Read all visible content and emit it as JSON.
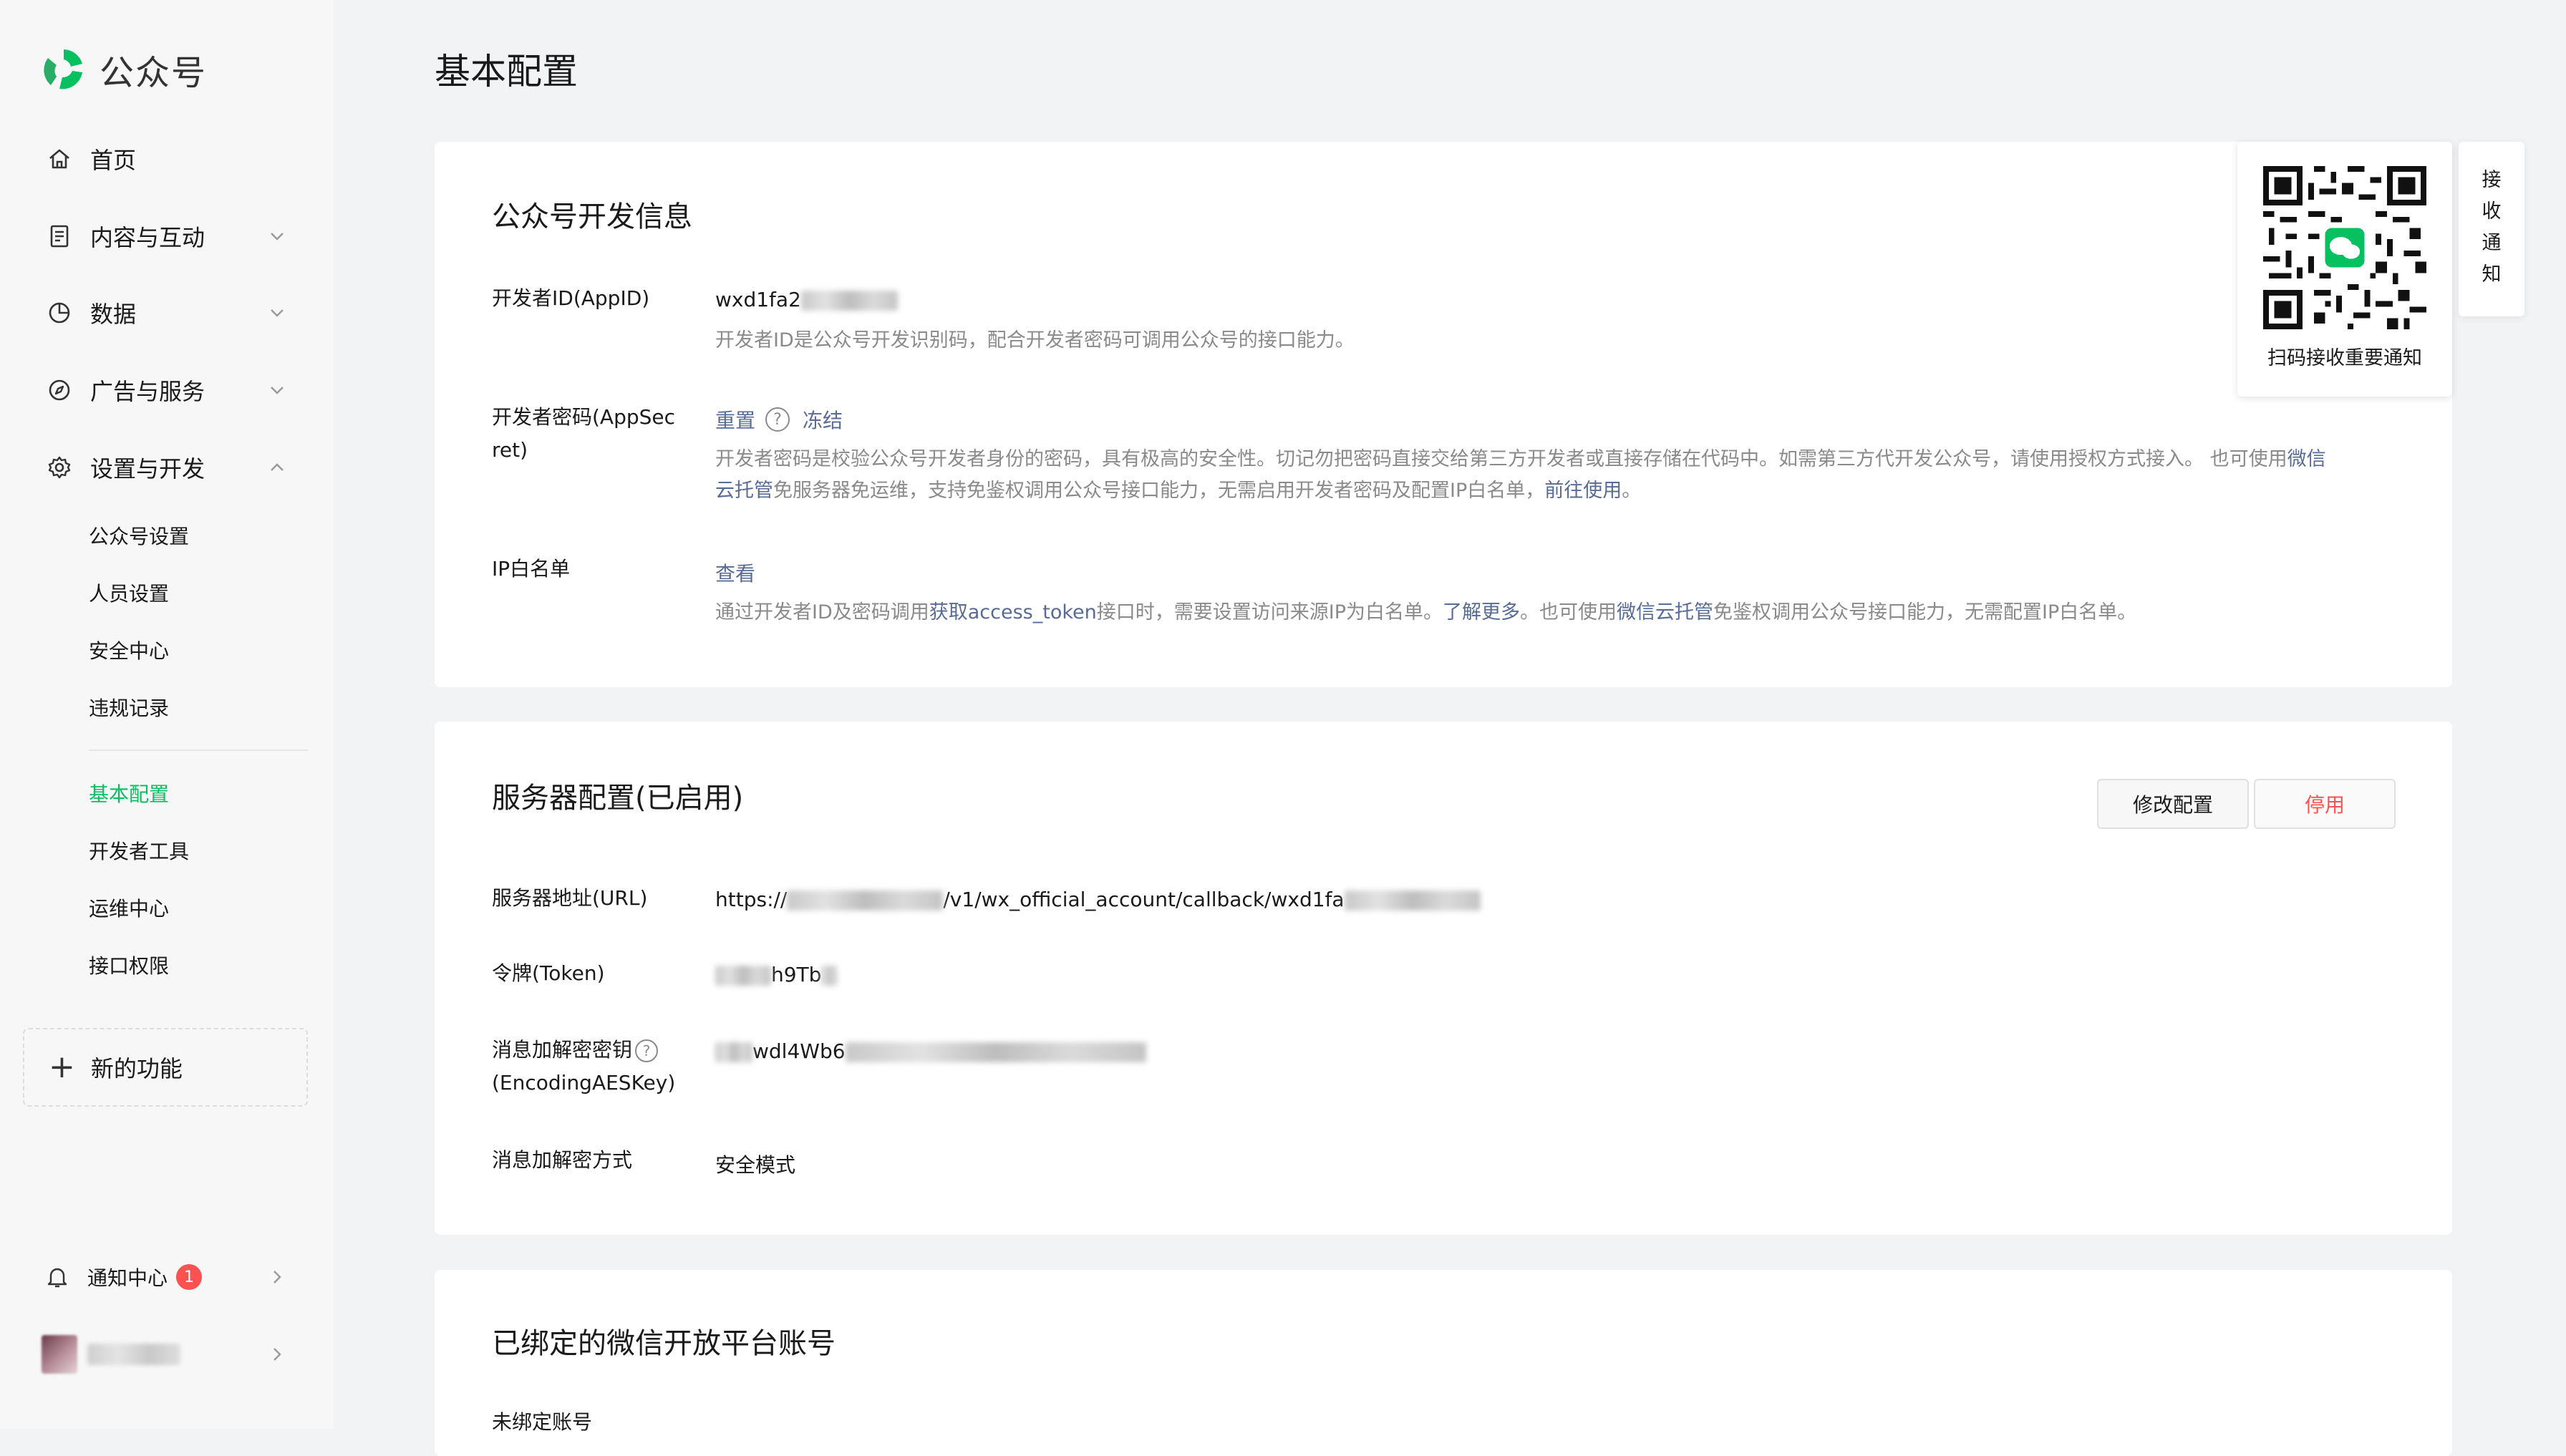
{
  "brand": {
    "name": "公众号",
    "accent": "#07c160"
  },
  "nav": {
    "home": "首页",
    "content": "内容与互动",
    "data": "数据",
    "ads": "广告与服务",
    "settings": "设置与开发",
    "sub": {
      "account": "公众号设置",
      "people": "人员设置",
      "security": "安全中心",
      "violation": "违规记录",
      "basic": "基本配置",
      "devtools": "开发者工具",
      "ops": "运维中心",
      "api": "接口权限"
    },
    "new_feature": "新的功能",
    "notify": "通知中心",
    "notify_count": "1"
  },
  "page": {
    "title": "基本配置"
  },
  "dev_info": {
    "title": "公众号开发信息",
    "appid_label": "开发者ID(AppID)",
    "appid_value": "wxd1fa2",
    "appid_desc": "开发者ID是公众号开发识别码，配合开发者密码可调用公众号的接口能力。",
    "secret_label_1": "开发者密码(AppSec",
    "secret_label_2": "ret)",
    "reset": "重置",
    "freeze": "冻结",
    "secret_desc_1": "开发者密码是校验公众号开发者身份的密码，具有极高的安全性。切记勿把密码直接交给第三方开发者或直接存储在代码中。如需第三方代开发公众号，请使用授权方式接入。 也可使用",
    "secret_desc_link1a": "微信",
    "secret_desc_link1b": "云托管",
    "secret_desc_2": "免服务器免运维，支持免鉴权调用公众号接口能力，无需启用开发者密码及配置IP白名单，",
    "secret_desc_link2": "前往使用",
    "secret_desc_end": "。",
    "ip_label": "IP白名单",
    "ip_view": "查看",
    "ip_desc_1": "通过开发者ID及密码调用",
    "ip_desc_link1": "获取access_token",
    "ip_desc_2": "接口时，需要设置访问来源IP为白名单。",
    "ip_desc_link2": "了解更多",
    "ip_desc_3": "。也可使用",
    "ip_desc_link3": "微信云托管",
    "ip_desc_4": "免鉴权调用公众号接口能力，无需配置IP白名单。"
  },
  "server": {
    "title": "服务器配置(已启用)",
    "edit": "修改配置",
    "stop": "停用",
    "url_label": "服务器地址(URL)",
    "url_prefix": "https://",
    "url_mid": "/v1/wx_official_account/callback/wxd1fa",
    "token_label": "令牌(Token)",
    "token_value": "h9Tb",
    "aes_label_1": "消息加解密密钥",
    "aes_label_2": "(EncodingAESKey)",
    "aes_value": "wdl4Wb6",
    "mode_label": "消息加解密方式",
    "mode_value": "安全模式"
  },
  "open_platform": {
    "title": "已绑定的微信开放平台账号",
    "sub_label": "未绑定账号"
  },
  "qr": {
    "caption": "扫码接收重要通知",
    "side_tab": [
      "接",
      "收",
      "通",
      "知"
    ]
  }
}
